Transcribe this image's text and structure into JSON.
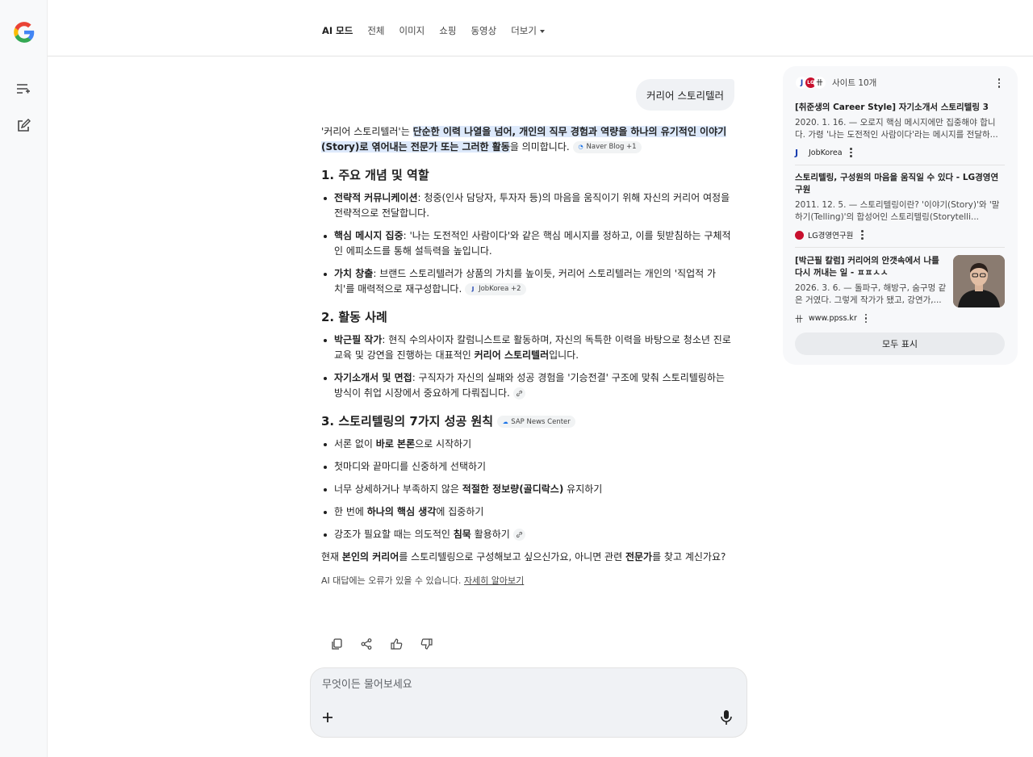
{
  "nav": {
    "tabs": [
      {
        "label": "AI 모드",
        "active": true
      },
      {
        "label": "전체"
      },
      {
        "label": "이미지"
      },
      {
        "label": "쇼핑"
      },
      {
        "label": "동영상"
      },
      {
        "label": "더보기"
      }
    ]
  },
  "query": "커리어 스토리텔러",
  "answer": {
    "intro_a": "'커리어 스토리텔러'는 ",
    "intro_hl": "단순한 이력 나열을 넘어, 개인의 직무 경험과 역량을 하나의 유기적인 이야기(Story)로 엮어내는 전문가 또는 그러한 활동",
    "intro_b": "을 의미합니다.",
    "intro_chip": "Naver Blog +1",
    "sections": [
      {
        "title": "1. 주요 개념 및 역할",
        "items": [
          {
            "bold": "전략적 커뮤니케이션",
            "text": ": 청중(인사 담당자, 투자자 등)의 마음을 움직이기 위해 자신의 커리어 여정을 전략적으로 전달합니다."
          },
          {
            "bold": "핵심 메시지 집중",
            "text": ": '나는 도전적인 사람이다'와 같은 핵심 메시지를 정하고, 이를 뒷받침하는 구체적인 에피소드를 통해 설득력을 높입니다."
          },
          {
            "bold": "가치 창출",
            "text": ": 브랜드 스토리텔러가 상품의 가치를 높이듯, 커리어 스토리텔러는 개인의 '직업적 가치'를 매력적으로 재구성합니다.",
            "chip": "JobKorea +2"
          }
        ]
      },
      {
        "title": "2. 활동 사례",
        "items": [
          {
            "bold": "박근필 작가",
            "text": ": 현직 수의사이자 칼럼니스트로 활동하며, 자신의 독특한 이력을 바탕으로 청소년 진로 교육 및 강연을 진행하는 대표적인 ",
            "bold2": "커리어 스토리텔러",
            "text2": "입니다."
          },
          {
            "bold": "자기소개서 및 면접",
            "text": ": 구직자가 자신의 실패와 성공 경험을 '기승전결' 구조에 맞춰 스토리텔링하는 방식이 취업 시장에서 중요하게 다뤄집니다."
          }
        ]
      },
      {
        "title": "3. 스토리텔링의 7가지 성공 원칙",
        "chip": "SAP News Center",
        "items": [
          {
            "pre": "서론 없이 ",
            "bold": "바로 본론",
            "text": "으로 시작하기"
          },
          {
            "pre": "첫마디와 끝마디를 신중하게 선택하기"
          },
          {
            "pre": "너무 상세하거나 부족하지 않은 ",
            "bold": "적절한 정보량(골디락스)",
            "text": " 유지하기"
          },
          {
            "pre": "한 번에 ",
            "bold": "하나의 핵심 생각",
            "text": "에 집중하기"
          },
          {
            "pre": "강조가 필요할 때는 의도적인 ",
            "bold": "침묵",
            "text": " 활용하기"
          }
        ]
      }
    ],
    "closing_a": "현재 ",
    "closing_b1": "본인의 커리어",
    "closing_c": "를 스토리텔링으로 구성해보고 싶으신가요, 아니면 관련 ",
    "closing_b2": "전문가",
    "closing_d": "를 찾고 계신가요?",
    "disclaimer": "AI 대답에는 오류가 있을 수 있습니다. ",
    "disclaimer_link": "자세히 알아보기"
  },
  "prompt": {
    "placeholder": "무엇이든 물어보세요"
  },
  "sources": {
    "header": "사이트 10개",
    "items": [
      {
        "title": "[취준생의 Career Style] 자기소개서 스토리텔링 3",
        "snippet": "2020. 1. 16. — 오로지 핵심 메시지에만 집중해야 합니다. 가령 '나는 도전적인 사람이다'라는 메시지를 전달하...",
        "site": "JobKorea"
      },
      {
        "title": "스토리텔링, 구성원의 마음을 움직일 수 있다 - LG경영연구원",
        "snippet": "2011. 12. 5. — 스토리텔링이란? '이야기(Story)'와 '말하기(Telling)'의 합성어인 스토리텔링(Storytelli...",
        "site": "LG경영연구원"
      },
      {
        "title": "[박근필 칼럼] 커리어의 안갯속에서 나를 다시 꺼내는 일 - ㅍㅍㅅㅅ",
        "snippet": "2026. 3. 6. — 돌파구, 해방구, 숨구멍 같은 거였다. 그렇게 작가가 됐고, 강연가,...",
        "site": "www.ppss.kr"
      }
    ],
    "show_all": "모두 표시"
  },
  "colors": {
    "highlight": "#dde9fb",
    "panel_bg": "#f7f8fa",
    "accent_blue": "#1a73e8"
  }
}
